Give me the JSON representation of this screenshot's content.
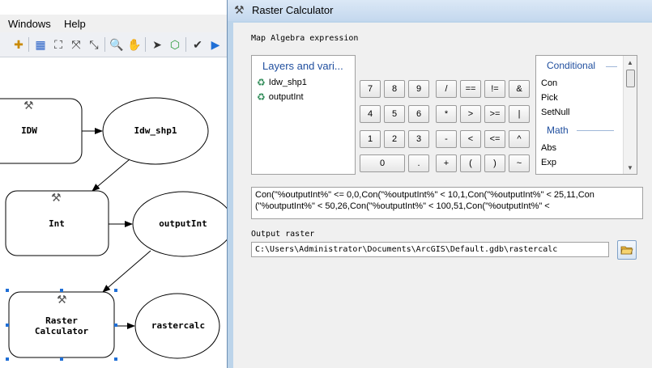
{
  "menubar": {
    "items": [
      "Windows",
      "Help"
    ]
  },
  "toolbar": {
    "icons": [
      "add-data-icon",
      "auto-layout-icon",
      "full-extent-icon",
      "zoom-in-fixed-icon",
      "zoom-out-fixed-icon",
      "zoom-in-icon",
      "pan-icon",
      "select-icon",
      "connect-icon",
      "validate-icon",
      "run-icon"
    ]
  },
  "model": {
    "nodes": [
      {
        "label": "IDW"
      },
      {
        "label": "Idw_shp1"
      },
      {
        "label": "Int"
      },
      {
        "label": "outputInt"
      },
      {
        "label": "Raster\nCalculator"
      },
      {
        "label": "rastercalc"
      }
    ]
  },
  "dialog": {
    "title": "Raster Calculator",
    "map_algebra_label": "Map Algebra expression",
    "layers_header": "Layers and vari...",
    "layers": [
      "Idw_shp1",
      "outputInt"
    ],
    "keypad": [
      [
        "7",
        "8",
        "9",
        "/",
        "==",
        "!=",
        "&"
      ],
      [
        "4",
        "5",
        "6",
        "*",
        ">",
        ">=",
        "|"
      ],
      [
        "1",
        "2",
        "3",
        "-",
        "<",
        "<=",
        "^"
      ],
      [
        "0",
        ".",
        "+",
        "(",
        ")",
        "~"
      ]
    ],
    "functions": {
      "conditional_header": "Conditional",
      "conditional": [
        "Con",
        "Pick",
        "SetNull"
      ],
      "math_header": "Math",
      "math": [
        "Abs",
        "Exp"
      ]
    },
    "expression_lines": [
      "Con(\"%outputInt%\" <= 0,0,Con(\"%outputInt%\" < 10,1,Con(\"%outputInt%\" < 25,11,Con",
      "(\"%outputInt%\" < 50,26,Con(\"%outputInt%\" < 100,51,Con(\"%outputInt%\" <"
    ],
    "output_raster_label": "Output raster",
    "output_raster_value": "C:\\Users\\Administrator\\Documents\\ArcGIS\\Default.gdb\\rastercalc"
  },
  "colors": {
    "header_blue": "#1f4e9e",
    "node_fill_selected": "#ffffff",
    "selection_handle": "#1f6fd6"
  }
}
